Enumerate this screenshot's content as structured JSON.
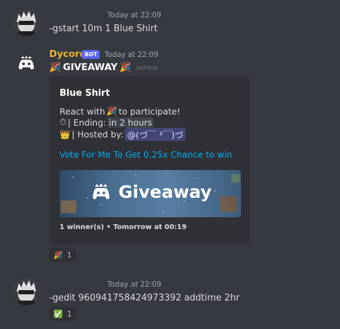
{
  "messages": {
    "first": {
      "timestamp": "Today at 22:09",
      "text": "-gstart 10m 1 Blue Shirt"
    },
    "bot": {
      "username": "Dycord",
      "tag": "BOT",
      "timestamp": "Today at 22:09",
      "headline": "GIVEAWAY",
      "edited": "(edited)",
      "embed": {
        "title": "Blue Shirt",
        "line1": "React with",
        "line1b": "to participate!",
        "line2_prefix": "| Ending:",
        "line2_value": "in 2 hours",
        "line3_prefix": "| Hosted by:",
        "line3_mention": "@(づ￣ ³￣)づ",
        "link": "Vote For Me To Get 0.25x Chance to win",
        "banner_text": "Giveaway",
        "footer": "1 winner(s) • Tomorrow at 00:19"
      },
      "reaction_count": "1"
    },
    "second": {
      "timestamp": "Today at 22:09",
      "text": "-gedit 960941758424973392 addtime 2hr",
      "reaction_count": "1"
    }
  },
  "colors": {
    "background": "#36393f",
    "embed_bg": "#2f3136",
    "username": "#f0b232",
    "bot_tag": "#5865f2",
    "link": "#00aff4",
    "mention_bg": "#414675"
  },
  "icons": {
    "party": "party-popper-icon",
    "timer": "stopwatch-icon",
    "crown": "crown-icon",
    "check": "check-mark-button-icon"
  }
}
